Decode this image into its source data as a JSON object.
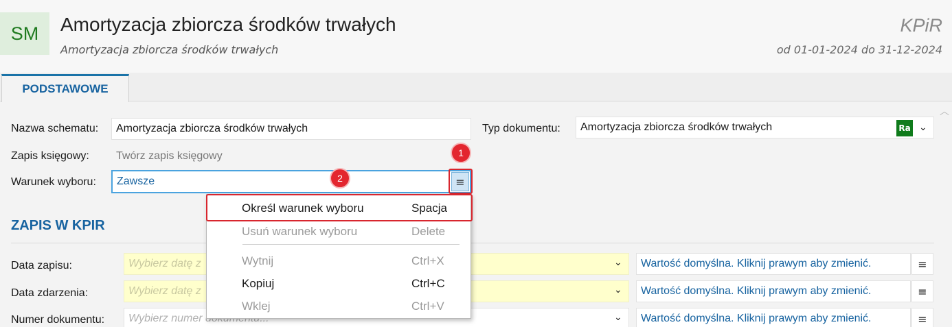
{
  "header": {
    "logo": "SM",
    "title": "Amortyzacja zbiorcza środków trwałych",
    "subtitle": "Amortyzacja zbiorcza środków trwałych",
    "book": "KPiR",
    "period": "od 01-01-2024 do 31-12-2024"
  },
  "tabs": [
    {
      "label": "PODSTAWOWE"
    }
  ],
  "form": {
    "scheme_name_label": "Nazwa schematu:",
    "scheme_name_value": "Amortyzacja zbiorcza środków trwałych",
    "doc_type_label": "Typ dokumentu:",
    "doc_type_value": "Amortyzacja zbiorcza środków trwałych",
    "doc_type_badge": "Ra",
    "booking_label": "Zapis księgowy:",
    "booking_value": "Twórz zapis księgowy",
    "condition_label": "Warunek wyboru:",
    "condition_value": "Zawsze",
    "menu_icon": "≡"
  },
  "callouts": [
    "1",
    "2"
  ],
  "section": {
    "title": "ZAPIS W KPIR",
    "rows": [
      {
        "label": "Data zapisu:",
        "placeholder": "Wybierz datę z",
        "default_text": "Wartość domyślna. Kliknij prawym aby zmienić."
      },
      {
        "label": "Data zdarzenia:",
        "placeholder": "Wybierz datę z",
        "default_text": "Wartość domyślna. Kliknij prawym aby zmienić."
      },
      {
        "label": "Numer dokumentu:",
        "placeholder": "Wybierz numer dokumentu...",
        "default_text": "Wartość domyślna. Kliknij prawym aby zmienić."
      }
    ]
  },
  "context_menu": {
    "items": [
      {
        "label": "Określ warunek wyboru",
        "shortcut": "Spacja",
        "enabled": true
      },
      {
        "label": "Usuń warunek wyboru",
        "shortcut": "Delete",
        "enabled": false
      },
      {
        "label": "Wytnij",
        "shortcut": "Ctrl+X",
        "enabled": false
      },
      {
        "label": "Kopiuj",
        "shortcut": "Ctrl+C",
        "enabled": true
      },
      {
        "label": "Wklej",
        "shortcut": "Ctrl+V",
        "enabled": false
      }
    ]
  },
  "colors": {
    "accent": "#1763a0",
    "highlight": "#d8262e",
    "badge_green": "#0f7b1b",
    "required": "#ffffcc"
  }
}
